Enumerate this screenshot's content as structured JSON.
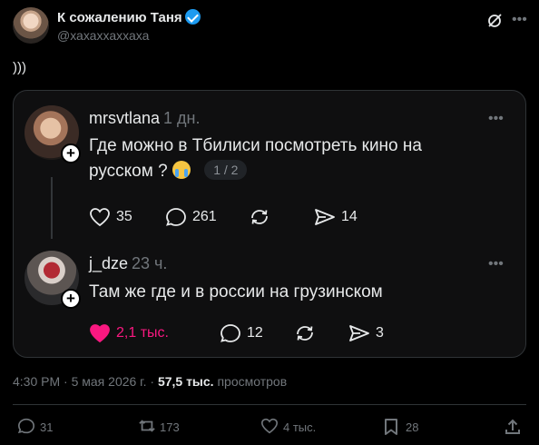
{
  "post": {
    "author_name": "К сожалению Таня",
    "author_handle": "@хахаххаххаха",
    "text": ")))"
  },
  "embedded": [
    {
      "name": "mrsvtlana",
      "time": "1 дн.",
      "text_line1": "Где можно в Тбилиси посмотреть кино на",
      "text_line2": "русском ?",
      "pager": "1 / 2",
      "likes": "35",
      "replies": "261",
      "reposts": "",
      "shares": "14"
    },
    {
      "name": "j_dze",
      "time": "23 ч.",
      "text": "Там же где и в россии на грузинском",
      "likes": "2,1 тыс.",
      "replies": "12",
      "reposts": "",
      "shares": "3"
    }
  ],
  "meta": {
    "time": "4:30 PM",
    "sep1": "·",
    "date": "5 мая 2026 г.",
    "sep2": "·",
    "views": "57,5 тыс.",
    "views_label": "просмотров"
  },
  "bottom_bar": {
    "replies": "31",
    "reposts": "173",
    "likes": "4 тыс.",
    "bookmarks": "28"
  },
  "colors": {
    "accent": "#1d9bf0",
    "like": "#f91880",
    "muted": "#71767b"
  },
  "icons": [
    "verified-icon",
    "grok-icon",
    "more-icon",
    "heart-icon",
    "reply-icon",
    "repost-icon",
    "share-icon",
    "bookmark-icon",
    "upload-icon"
  ]
}
